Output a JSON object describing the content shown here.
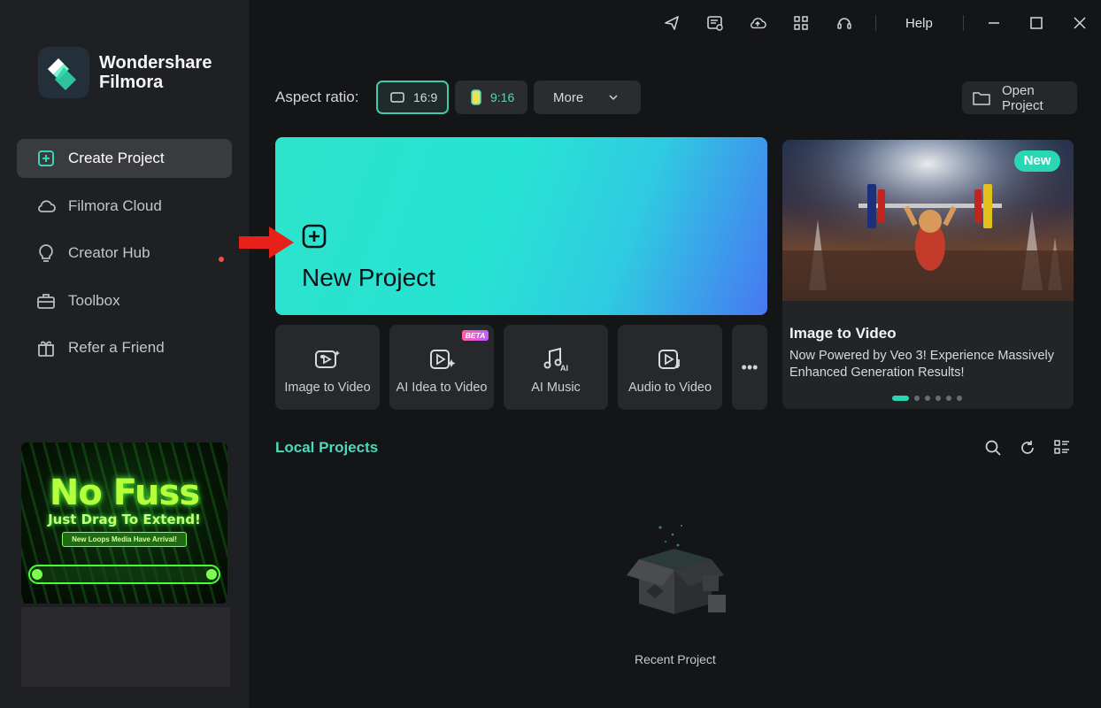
{
  "app": {
    "brand_line1": "Wondershare",
    "brand_line2": "Filmora"
  },
  "titlebar": {
    "icons": [
      "send-icon",
      "task-list-icon",
      "cloud-upload-icon",
      "apps-grid-icon",
      "headset-icon"
    ],
    "help_label": "Help",
    "window_controls": [
      "minimize-icon",
      "maximize-icon",
      "close-icon"
    ]
  },
  "sidebar": {
    "items": [
      {
        "label": "Create Project",
        "icon": "plus-square-icon",
        "active": true
      },
      {
        "label": "Filmora Cloud",
        "icon": "cloud-icon"
      },
      {
        "label": "Creator Hub",
        "icon": "lightbulb-icon",
        "notification_dot": true
      },
      {
        "label": "Toolbox",
        "icon": "toolbox-icon"
      },
      {
        "label": "Refer a Friend",
        "icon": "gift-icon"
      }
    ],
    "promo": {
      "headline": "No Fuss",
      "subline": "Just Drag To Extend!",
      "tagline": "New Loops Media Have Arrival!"
    }
  },
  "aspect": {
    "label": "Aspect ratio:",
    "options": [
      "16:9",
      "9:16"
    ],
    "selected": "16:9",
    "more_label": "More"
  },
  "open_project_label": "Open Project",
  "hero": {
    "title": "New Project"
  },
  "tools": [
    {
      "label": "Image to Video",
      "icon": "image-to-video-icon"
    },
    {
      "label": "AI Idea to Video",
      "icon": "ai-idea-to-video-icon",
      "badge": "BETA"
    },
    {
      "label": "AI Music",
      "icon": "ai-music-icon"
    },
    {
      "label": "Audio to Video",
      "icon": "audio-to-video-icon"
    }
  ],
  "more_tools_label": "•••",
  "banner": {
    "badge": "New",
    "title": "Image to Video",
    "description": "Now Powered by Veo 3! Experience Massively Enhanced Generation Results!",
    "slide_count": 6,
    "active_slide": 1
  },
  "local_projects": {
    "title": "Local Projects",
    "icons": [
      "search-icon",
      "refresh-icon",
      "list-view-icon"
    ],
    "empty_label": "Recent Project"
  },
  "colors": {
    "accent": "#2ad7b5",
    "hero_gradient_start": "#2de3cb",
    "hero_gradient_end": "#4778f2",
    "background": "#141517",
    "sidebar": "#1f2023"
  }
}
